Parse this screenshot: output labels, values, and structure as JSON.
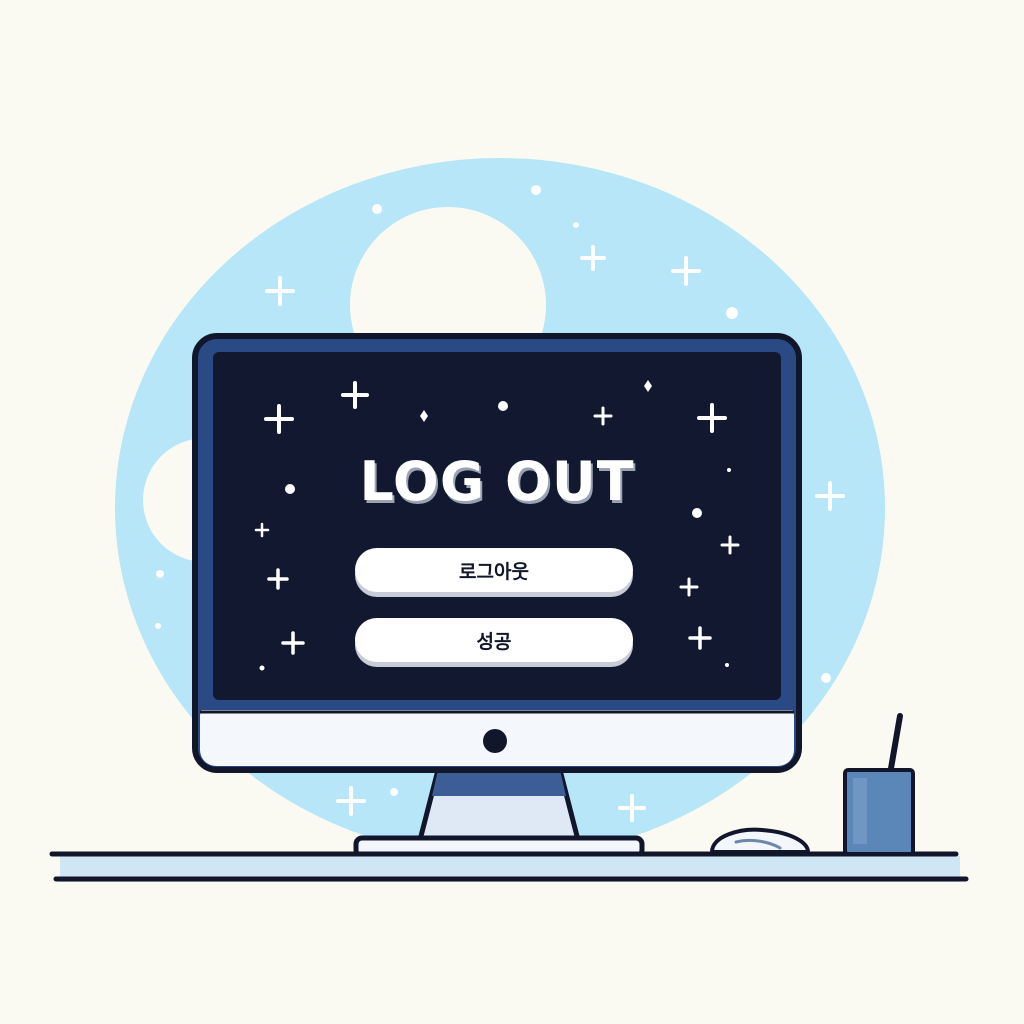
{
  "screen": {
    "title": "LOG OUT",
    "buttons": [
      {
        "label": "로그아웃"
      },
      {
        "label": "성공"
      }
    ]
  },
  "colors": {
    "background": "#fafaf3",
    "blob": "#b6e6f7",
    "screen": "#12182f",
    "monitor_frame": "#2a4a86",
    "outline": "#12162b",
    "cup": "#5a86b8",
    "sparkle": "#ffffff"
  },
  "icons": [
    "sparkle-icon",
    "power-button-icon"
  ]
}
